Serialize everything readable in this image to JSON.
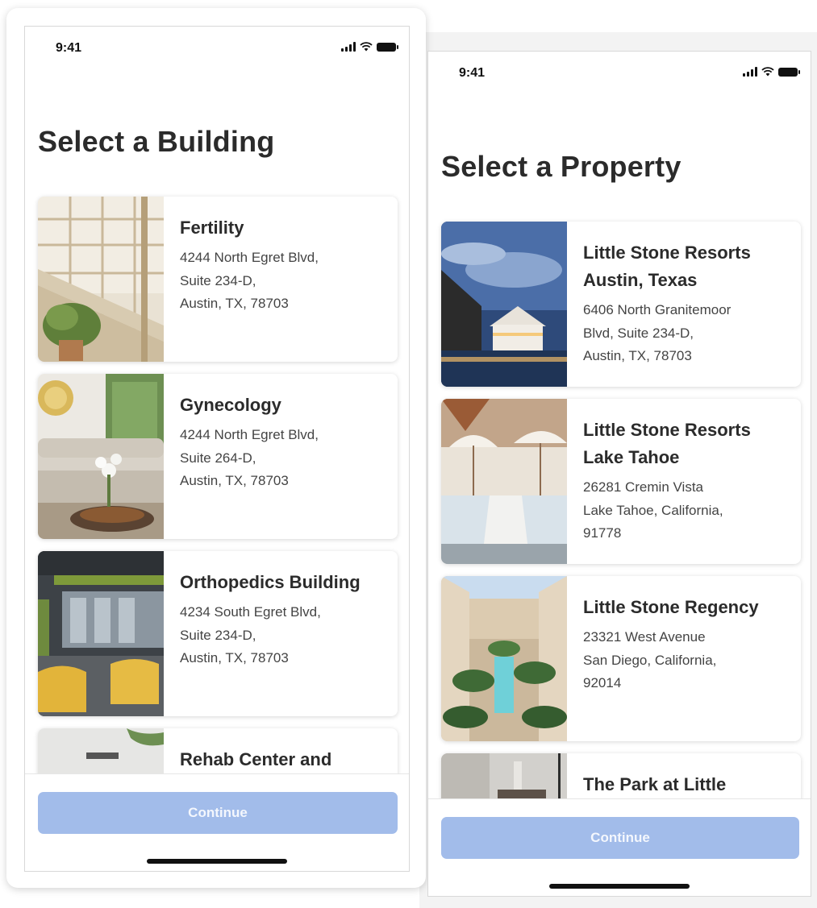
{
  "colors": {
    "continue_bg": "#a2bcea",
    "continue_text": "#f4f7fd",
    "title_text": "#2b2b2b"
  },
  "left_screen": {
    "status_time": "9:41",
    "title": "Select a Building",
    "items": [
      {
        "name": "Fertility",
        "address": [
          "4244 North Egret Blvd,",
          "Suite 234-D,",
          "Austin, TX, 78703"
        ],
        "image": "atrium-staircase-photo"
      },
      {
        "name": "Gynecology",
        "address": [
          "4244 North Egret Blvd,",
          "Suite 264-D,",
          "Austin, TX, 78703"
        ],
        "image": "lounge-sofa-photo"
      },
      {
        "name": "Orthopedics Building",
        "address": [
          "4234 South Egret Blvd,",
          "Suite 234-D,",
          "Austin, TX, 78703"
        ],
        "image": "office-yellow-chairs-photo"
      },
      {
        "name": "Rehab Center and",
        "address": [],
        "image": "rehab-room-photo"
      }
    ],
    "continue_label": "Continue"
  },
  "right_screen": {
    "status_time": "9:41",
    "title": "Select a Property",
    "items": [
      {
        "name": "Little Stone Resorts Austin, Texas",
        "address": [
          "6406 North Granitemoor",
          "Blvd, Suite 234-D,",
          "Austin, TX, 78703"
        ],
        "image": "resort-pool-dusk-photo"
      },
      {
        "name": "Little Stone Resorts Lake Tahoe",
        "address": [
          "26281 Cremin Vista",
          "Lake Tahoe, California,",
          "91778"
        ],
        "image": "resort-umbrellas-photo"
      },
      {
        "name": "Little Stone Regency",
        "address": [
          "23321 West Avenue",
          "San Diego, California,",
          "92014"
        ],
        "image": "courtyard-palms-photo"
      },
      {
        "name": "The Park at Little",
        "address": [],
        "image": "park-interior-photo"
      }
    ],
    "continue_label": "Continue"
  }
}
